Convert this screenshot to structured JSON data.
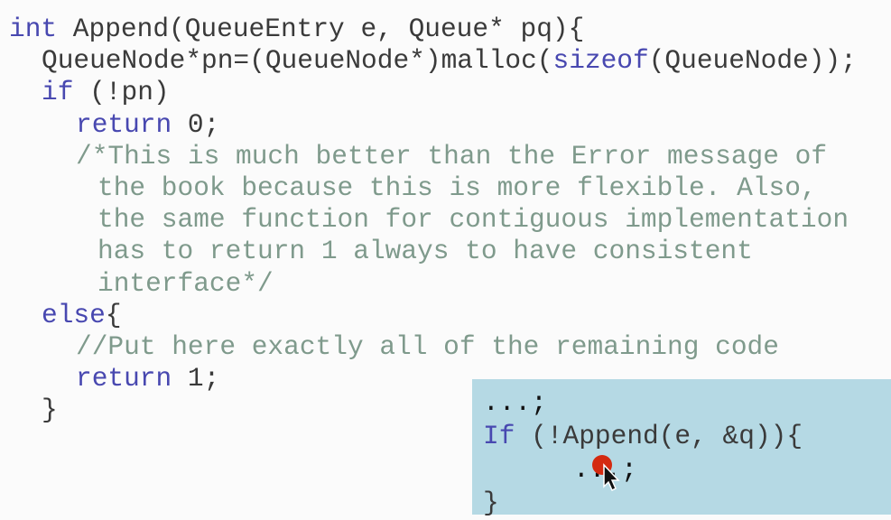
{
  "code": {
    "lines": [
      {
        "kw": "int",
        "text": " Append(QueueEntry e, Queue* pq){"
      },
      {
        "text": "QueueNode*pn=(QueueNode*)malloc(",
        "kw": "sizeof",
        "after": "(QueueNode));"
      },
      {
        "kw": "if",
        "text": " (!pn)"
      },
      {
        "kw": "return",
        "text": " 0;"
      },
      {
        "comment": "/*This is much better than the Error message of"
      },
      {
        "comment": "the book because this is more flexible. Also,"
      },
      {
        "comment": "the same function for contiguous implementation"
      },
      {
        "comment": "has to return 1 always to have consistent"
      },
      {
        "comment": "interface*/"
      },
      {
        "kw": "else",
        "text": "{"
      },
      {
        "comment": "//Put here exactly all of the remaining code"
      },
      {
        "kw": "return",
        "text": " 1;"
      },
      {
        "text": "}"
      }
    ]
  },
  "popup": {
    "line1": "...;",
    "line2_kw": "If",
    "line2_text": " (!Append(e, &q)){",
    "line3": "...;",
    "line4": "}"
  },
  "colors": {
    "keyword": "#4848b0",
    "comment": "#7f9a8c",
    "popup_bg": "#b5d9e4",
    "pointer_dot": "#d42a10"
  }
}
